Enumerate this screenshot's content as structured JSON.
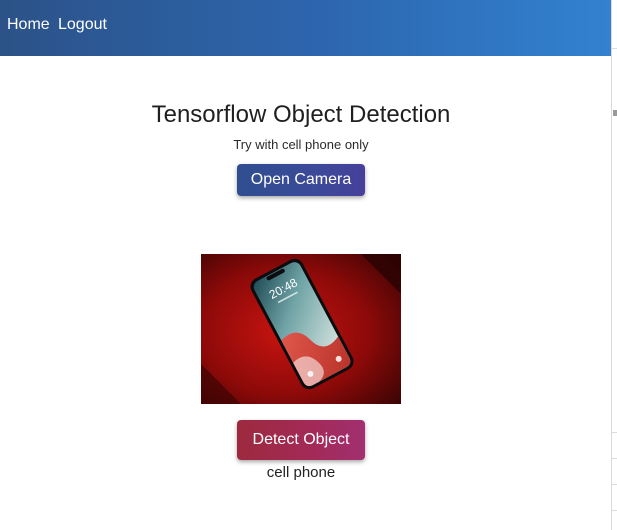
{
  "navbar": {
    "links": [
      {
        "label": "Home"
      },
      {
        "label": "Logout"
      }
    ]
  },
  "main": {
    "title": "Tensorflow Object Detection",
    "subtitle": "Try with cell phone only",
    "open_camera_label": "Open Camera",
    "detect_label": "Detect Object",
    "result": "cell phone",
    "image": {
      "clock_time": "20:48",
      "subject": "smartphone-on-red-surface"
    }
  },
  "colors": {
    "navbar_start": "#2c5288",
    "navbar_end": "#3282d0",
    "camera_button": "#3b4a99",
    "detect_button": "#a32a58"
  }
}
